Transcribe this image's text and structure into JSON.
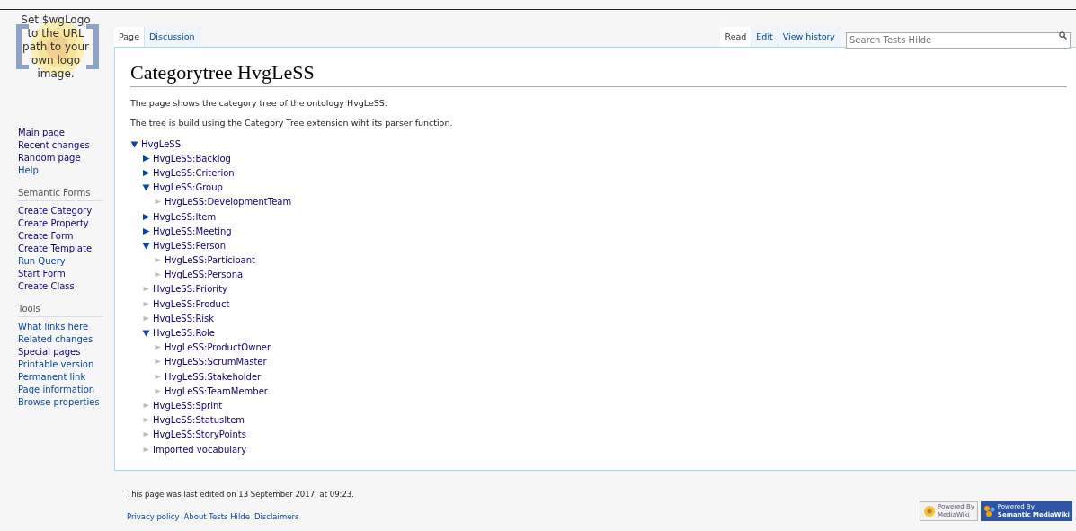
{
  "logo": {
    "text": "Set $wgLogo to the URL path to your own logo image."
  },
  "sidebar": {
    "navigation": [
      {
        "label": "Main page",
        "visited": true
      },
      {
        "label": "Recent changes",
        "visited": true
      },
      {
        "label": "Random page",
        "visited": true
      },
      {
        "label": "Help",
        "visited": false
      }
    ],
    "portals": [
      {
        "heading": "Semantic Forms",
        "items": [
          {
            "label": "Create Category",
            "visited": true
          },
          {
            "label": "Create Property",
            "visited": true
          },
          {
            "label": "Create Form",
            "visited": true
          },
          {
            "label": "Create Template",
            "visited": true
          },
          {
            "label": "Run Query",
            "visited": false
          },
          {
            "label": "Start Form",
            "visited": true
          },
          {
            "label": "Create Class",
            "visited": true
          }
        ]
      },
      {
        "heading": "Tools",
        "items": [
          {
            "label": "What links here",
            "visited": false
          },
          {
            "label": "Related changes",
            "visited": false
          },
          {
            "label": "Special pages",
            "visited": true
          },
          {
            "label": "Printable version",
            "visited": false
          },
          {
            "label": "Permanent link",
            "visited": false
          },
          {
            "label": "Page information",
            "visited": false
          },
          {
            "label": "Browse properties",
            "visited": false
          }
        ]
      }
    ]
  },
  "tabs_left": [
    {
      "label": "Page",
      "selected": true
    },
    {
      "label": "Discussion",
      "selected": false
    }
  ],
  "tabs_right": [
    {
      "label": "Read",
      "selected": true
    },
    {
      "label": "Edit",
      "selected": false
    },
    {
      "label": "View history",
      "selected": false
    }
  ],
  "search": {
    "placeholder": "Search Tests Hilde"
  },
  "heading": "Categorytree HvgLeSS",
  "paragraphs": [
    "The page shows the category tree of the ontology HvgLeSS.",
    "The tree is build using the Category Tree extension wiht its parser function."
  ],
  "tree": {
    "label": "HvgLeSS",
    "expanded": true,
    "has_children": true,
    "children": [
      {
        "label": "HvgLeSS:Backlog",
        "expanded": false,
        "has_children": true
      },
      {
        "label": "HvgLeSS:Criterion",
        "expanded": false,
        "has_children": true
      },
      {
        "label": "HvgLeSS:Group",
        "expanded": true,
        "has_children": true,
        "children": [
          {
            "label": "HvgLeSS:DevelopmentTeam",
            "expanded": false,
            "has_children": false
          }
        ]
      },
      {
        "label": "HvgLeSS:Item",
        "expanded": false,
        "has_children": true
      },
      {
        "label": "HvgLeSS:Meeting",
        "expanded": false,
        "has_children": true
      },
      {
        "label": "HvgLeSS:Person",
        "expanded": true,
        "has_children": true,
        "children": [
          {
            "label": "HvgLeSS:Participant",
            "expanded": false,
            "has_children": false
          },
          {
            "label": "HvgLeSS:Persona",
            "expanded": false,
            "has_children": false
          }
        ]
      },
      {
        "label": "HvgLeSS:Priority",
        "expanded": false,
        "has_children": false
      },
      {
        "label": "HvgLeSS:Product",
        "expanded": false,
        "has_children": false
      },
      {
        "label": "HvgLeSS:Risk",
        "expanded": false,
        "has_children": false
      },
      {
        "label": "HvgLeSS:Role",
        "expanded": true,
        "has_children": true,
        "children": [
          {
            "label": "HvgLeSS:ProductOwner",
            "expanded": false,
            "has_children": false
          },
          {
            "label": "HvgLeSS:ScrumMaster",
            "expanded": false,
            "has_children": false
          },
          {
            "label": "HvgLeSS:Stakeholder",
            "expanded": false,
            "has_children": false
          },
          {
            "label": "HvgLeSS:TeamMember",
            "expanded": false,
            "has_children": false
          }
        ]
      },
      {
        "label": "HvgLeSS:Sprint",
        "expanded": false,
        "has_children": false
      },
      {
        "label": "HvgLeSS:StatusItem",
        "expanded": false,
        "has_children": false
      },
      {
        "label": "HvgLeSS:StoryPoints",
        "expanded": false,
        "has_children": false
      },
      {
        "label": "Imported vocabulary",
        "expanded": false,
        "has_children": false
      }
    ]
  },
  "footer": {
    "last_edited": "This page was last edited on 13 September 2017, at 09:23.",
    "links": [
      "Privacy policy",
      "About Tests Hilde",
      "Disclaimers"
    ],
    "badges": [
      {
        "top": "Powered By",
        "name": "MediaWiki"
      },
      {
        "top": "Powered By",
        "name": "Semantic MediaWiki"
      }
    ]
  }
}
